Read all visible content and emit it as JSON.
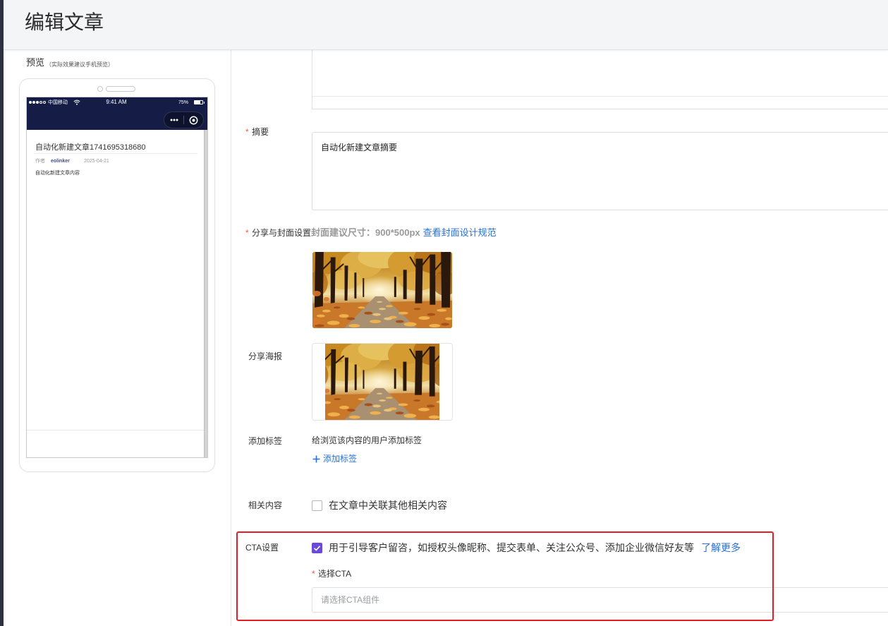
{
  "header": {
    "title": "编辑文章"
  },
  "preview": {
    "label": "预览",
    "hint": "（实际效果建议手机预览）",
    "phone": {
      "signal_strength": 3,
      "signal_max": 5,
      "carrier": "中国移动",
      "time": "9:41 AM",
      "battery": "75%",
      "article": {
        "title": "自动化新建文章1741695318680",
        "author_label": "作者",
        "author": "eolinker",
        "date": "2025-04-21",
        "content": "自动化新建文章内容"
      }
    }
  },
  "form": {
    "summary": {
      "required_mark": "*",
      "label": "摘要",
      "value": "自动化新建文章摘要"
    },
    "cover": {
      "required_mark": "*",
      "label": "分享与封面设置",
      "hint": "封面建议尺寸：900*500px",
      "guide_link": "查看封面设计规范"
    },
    "poster": {
      "label": "分享海报"
    },
    "tags": {
      "label": "添加标签",
      "hint": "给浏览该内容的用户添加标签",
      "add_button": "添加标签"
    },
    "related": {
      "label": "相关内容",
      "option": "在文章中关联其他相关内容",
      "checked": false
    },
    "cta": {
      "label": "CTA设置",
      "option": "用于引导客户留咨，如授权头像昵称、提交表单、关注公众号、添加企业微信好友等",
      "learn_more": "了解更多",
      "checked": true,
      "select": {
        "required_mark": "*",
        "label": "选择CTA",
        "placeholder": "请选择CTA组件"
      }
    }
  },
  "icons": {
    "signal": "signal-strength-icon",
    "wifi": "wifi-icon",
    "battery": "battery-icon",
    "capsule_more": "more-icon",
    "capsule_close": "mini-program-close-icon",
    "add_tag": "plus-icon",
    "checkbox_checked": "check-icon"
  },
  "colors": {
    "accent_blue": "#2870d6",
    "required_red": "#f2584a",
    "checkbox_purple": "#6a4bd9",
    "highlight_red": "#e31e24",
    "status_bar": "#151d46",
    "header_bg": "#f4f5f7"
  }
}
